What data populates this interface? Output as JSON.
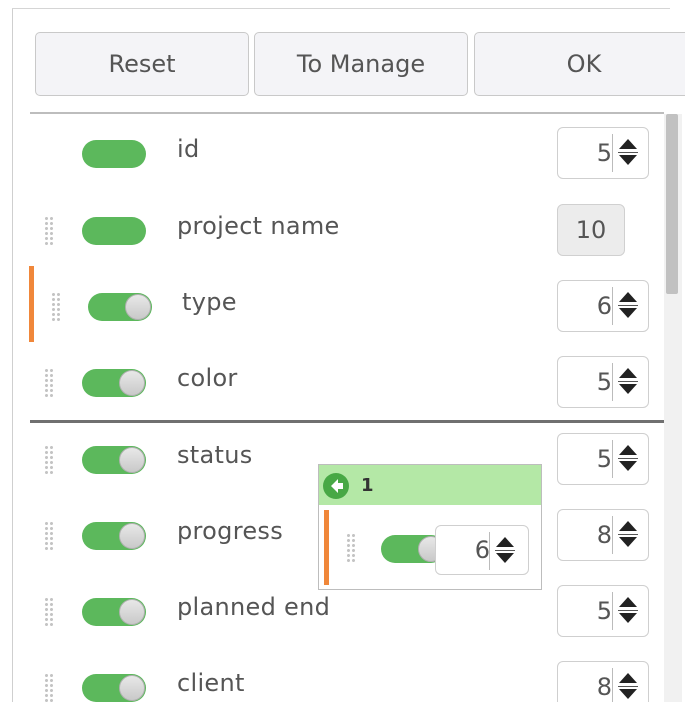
{
  "buttons": {
    "reset": "Reset",
    "to_manage": "To Manage",
    "ok": "OK"
  },
  "rows": [
    {
      "label": "id",
      "value": "5",
      "editable": true
    },
    {
      "label": "project name",
      "value": "10",
      "editable": false
    },
    {
      "label": "type",
      "value": "6",
      "editable": true
    },
    {
      "label": "color",
      "value": "5",
      "editable": true
    },
    {
      "label": "status",
      "value": "5",
      "editable": true
    },
    {
      "label": "progress",
      "value": "8",
      "editable": true
    },
    {
      "label": "planned end",
      "value": "5",
      "editable": true
    },
    {
      "label": "client",
      "value": "8",
      "editable": true
    }
  ],
  "popup": {
    "count": "1",
    "value": "6"
  },
  "colors": {
    "toggle_on": "#5cb85c",
    "drag_indicator": "#f0873a",
    "popup_header": "#b4e8a6"
  }
}
